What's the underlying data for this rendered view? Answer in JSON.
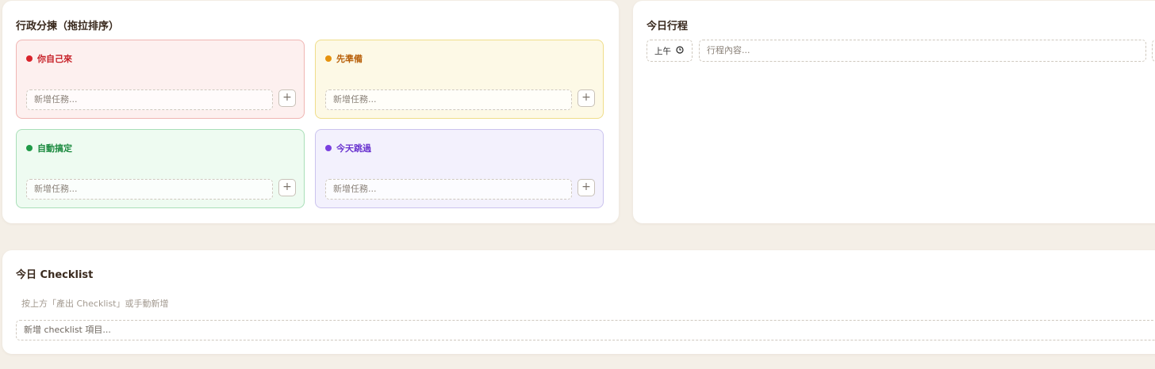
{
  "triage": {
    "title": "行政分揀（拖拉排序）",
    "quadrants": [
      {
        "label": "你自己來",
        "color": "#d9232b",
        "input_placeholder": "新增任務...",
        "add_label": "+"
      },
      {
        "label": "先準備",
        "color": "#e6930f",
        "input_placeholder": "新增任務...",
        "add_label": "+"
      },
      {
        "label": "自動搞定",
        "color": "#1f9a47",
        "input_placeholder": "新增任務...",
        "add_label": "+"
      },
      {
        "label": "今天跳過",
        "color": "#7a3fe0",
        "input_placeholder": "新增任務...",
        "add_label": "+"
      }
    ],
    "label_colors": [
      "#c72128",
      "#b8600a",
      "#1b8a3f",
      "#6a34cf"
    ]
  },
  "schedule": {
    "title": "今日行程",
    "time_value": "上午",
    "time_icon": "clock-icon",
    "content_placeholder": "行程內容..."
  },
  "checklist": {
    "title": "今日 Checklist",
    "hint": "按上方「產出 Checklist」或手動新增",
    "input_placeholder": "新增 checklist 項目..."
  }
}
